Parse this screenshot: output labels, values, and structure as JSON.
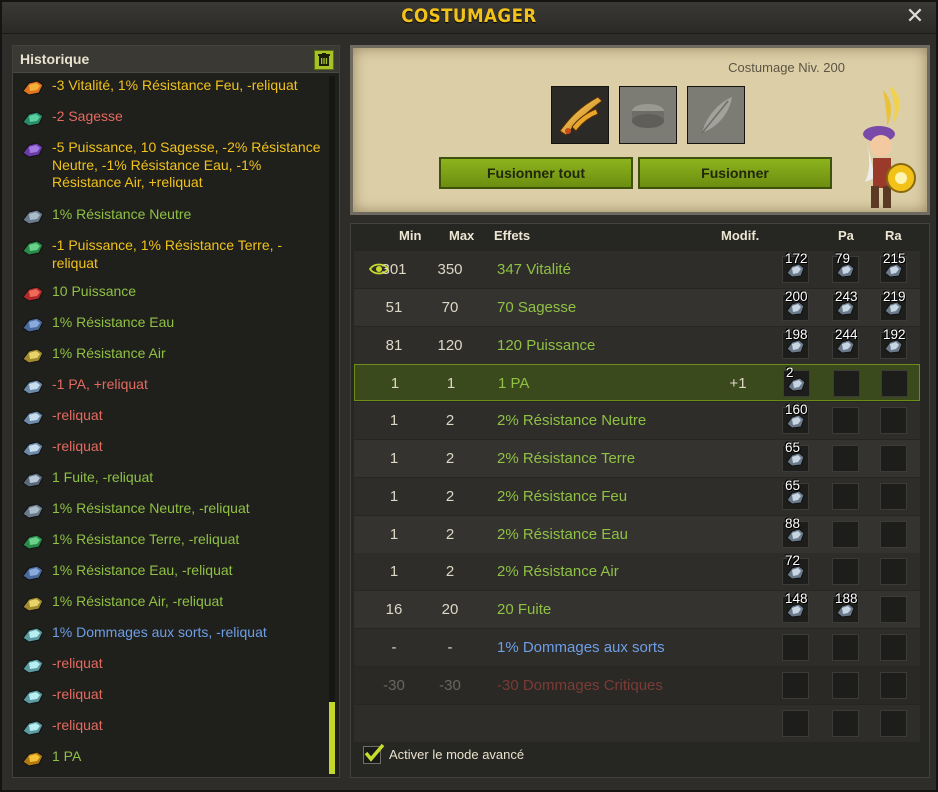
{
  "window": {
    "title": "COSTUMAGER",
    "close_icon": "close-icon"
  },
  "history": {
    "title": "Historique",
    "entries": [
      {
        "icon": "fire-rune-icon",
        "color": "yellow",
        "text": "-3 Vitalité, 1% Résistance Feu, -reliquat"
      },
      {
        "icon": "water-rune-icon",
        "color": "red",
        "text": "-2 Sagesse"
      },
      {
        "icon": "purple-rune-icon",
        "color": "yellow",
        "text": "-5 Puissance, 10 Sagesse, -2% Résistance Neutre, -1% Résistance Eau, -1% Résistance Air, +reliquat"
      },
      {
        "icon": "neutral-rune-icon",
        "color": "green",
        "text": "1% Résistance Neutre"
      },
      {
        "icon": "earth-rune-icon",
        "color": "yellow",
        "text": "-1 Puissance, 1% Résistance Terre, -reliquat"
      },
      {
        "icon": "power-rune-icon",
        "color": "green",
        "text": "10 Puissance"
      },
      {
        "icon": "water-res-rune-icon",
        "color": "green",
        "text": "1% Résistance Eau"
      },
      {
        "icon": "air-res-rune-icon",
        "color": "green",
        "text": "1% Résistance Air"
      },
      {
        "icon": "pa-rune-icon",
        "color": "red",
        "text": "-1 PA, +reliquat"
      },
      {
        "icon": "small-rune-icon",
        "color": "red",
        "text": "-reliquat"
      },
      {
        "icon": "small-rune-icon",
        "color": "red",
        "text": "-reliquat"
      },
      {
        "icon": "flee-rune-icon",
        "color": "green",
        "text": "1 Fuite, -reliquat"
      },
      {
        "icon": "neutral-rune-icon",
        "color": "green",
        "text": "1% Résistance Neutre, -reliquat"
      },
      {
        "icon": "earth-rune-icon",
        "color": "green",
        "text": "1% Résistance Terre, -reliquat"
      },
      {
        "icon": "water-res-rune-icon",
        "color": "green",
        "text": "1% Résistance Eau, -reliquat"
      },
      {
        "icon": "air-res-rune-icon",
        "color": "green",
        "text": "1% Résistance Air, -reliquat"
      },
      {
        "icon": "spell-damage-rune-icon",
        "color": "blue",
        "text": "1% Dommages aux sorts, -reliquat"
      },
      {
        "icon": "spell-damage-rune-icon",
        "color": "red",
        "text": "-reliquat"
      },
      {
        "icon": "spell-damage-rune-icon",
        "color": "red",
        "text": "-reliquat"
      },
      {
        "icon": "spell-damage-rune-icon",
        "color": "red",
        "text": "-reliquat"
      },
      {
        "icon": "pa-gold-rune-icon",
        "color": "green",
        "text": "1 PA"
      }
    ]
  },
  "merge": {
    "level": "Costumage Niv. 200",
    "btn_all": "Fusionner tout",
    "btn_one": "Fusionner"
  },
  "effects": {
    "headers": {
      "min": "Min",
      "max": "Max",
      "effects": "Effets",
      "modif": "Modif.",
      "pa": "Pa",
      "ra": "Ra"
    },
    "rows": [
      {
        "min": "301",
        "max": "350",
        "effect": "347 Vitalité",
        "modif": "",
        "ba": "172",
        "pa": "79",
        "ra": "215",
        "eye": true
      },
      {
        "min": "51",
        "max": "70",
        "effect": "70 Sagesse",
        "modif": "",
        "ba": "200",
        "pa": "243",
        "ra": "219"
      },
      {
        "min": "81",
        "max": "120",
        "effect": "120 Puissance",
        "modif": "",
        "ba": "198",
        "pa": "244",
        "ra": "192"
      },
      {
        "min": "1",
        "max": "1",
        "effect": "1 PA",
        "modif": "+1",
        "ba": "2",
        "pa": "",
        "ra": "",
        "selected": true
      },
      {
        "min": "1",
        "max": "2",
        "effect": "2% Résistance Neutre",
        "modif": "",
        "ba": "160",
        "pa": "",
        "ra": ""
      },
      {
        "min": "1",
        "max": "2",
        "effect": "2% Résistance Terre",
        "modif": "",
        "ba": "65",
        "pa": "",
        "ra": ""
      },
      {
        "min": "1",
        "max": "2",
        "effect": "2% Résistance Feu",
        "modif": "",
        "ba": "65",
        "pa": "",
        "ra": ""
      },
      {
        "min": "1",
        "max": "2",
        "effect": "2% Résistance Eau",
        "modif": "",
        "ba": "88",
        "pa": "",
        "ra": ""
      },
      {
        "min": "1",
        "max": "2",
        "effect": "2% Résistance Air",
        "modif": "",
        "ba": "72",
        "pa": "",
        "ra": ""
      },
      {
        "min": "16",
        "max": "20",
        "effect": "20 Fuite",
        "modif": "",
        "ba": "148",
        "pa": "188",
        "ra": ""
      },
      {
        "min": "-",
        "max": "-",
        "effect": "1% Dommages aux sorts",
        "modif": "",
        "ba": "",
        "pa": "",
        "ra": "",
        "blue": true
      },
      {
        "min": "-30",
        "max": "-30",
        "effect": "-30 Dommages Critiques",
        "modif": "",
        "ba": "",
        "pa": "",
        "ra": "",
        "dim": true
      },
      {
        "min": "",
        "max": "",
        "effect": "",
        "modif": "",
        "ba": "",
        "pa": "",
        "ra": "",
        "empty": true
      }
    ],
    "advanced_label": "Activer le mode avancé"
  },
  "colors": {
    "accent_yellow": "#f3c21a",
    "effect_green": "#8fc144",
    "history_red": "#e36b60",
    "history_blue": "#6e9fe6",
    "button_green": "#8db41e"
  }
}
